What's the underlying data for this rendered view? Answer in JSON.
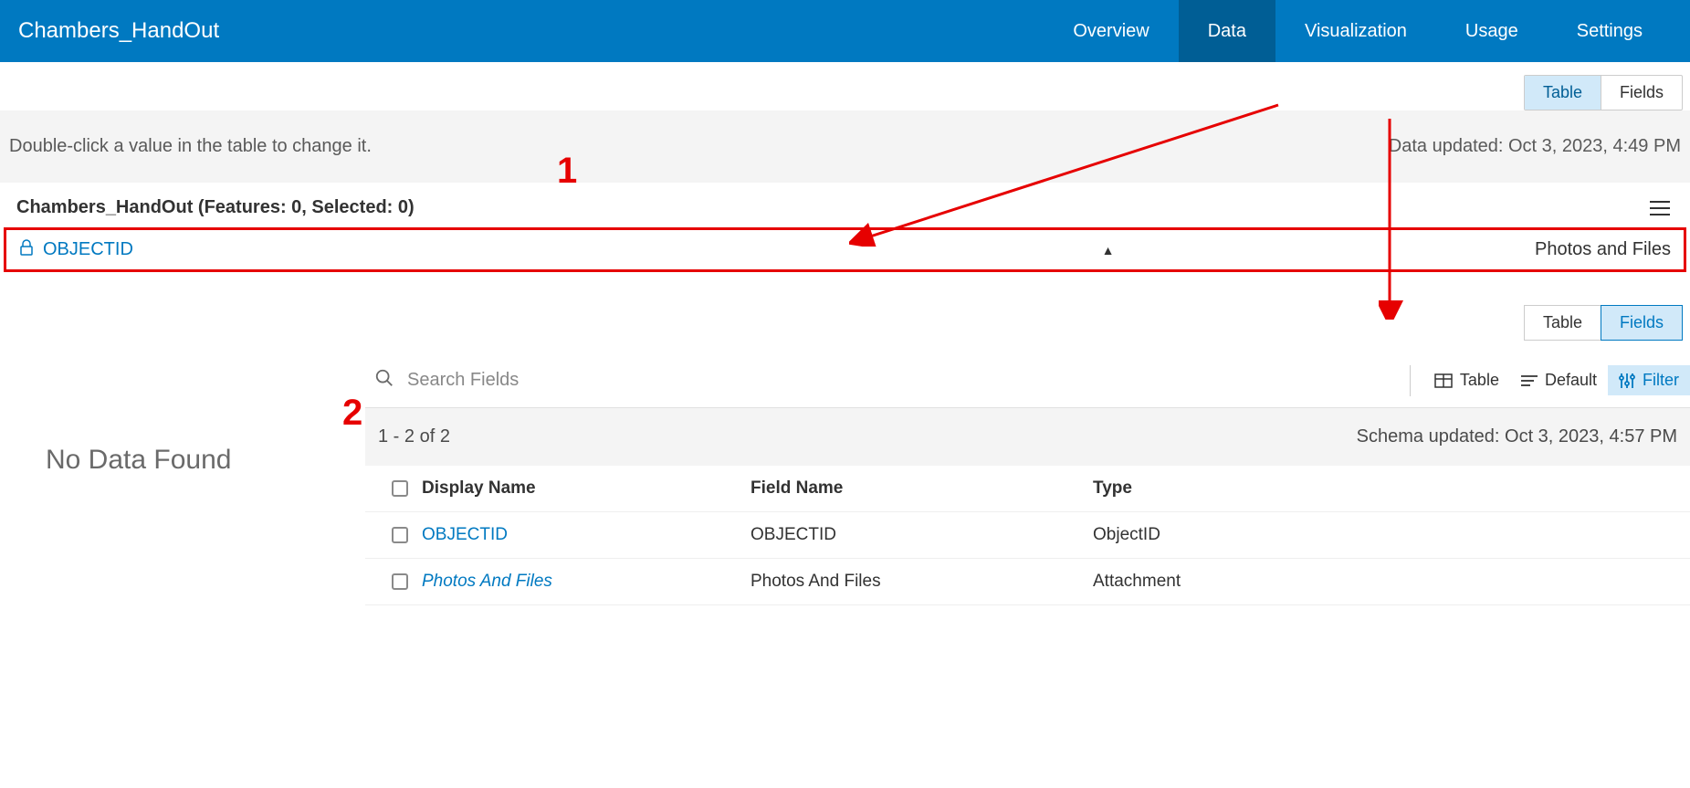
{
  "header": {
    "title": "Chambers_HandOut",
    "tabs": [
      "Overview",
      "Data",
      "Visualization",
      "Usage",
      "Settings"
    ],
    "active_tab": "Data"
  },
  "subtabs1": {
    "table": "Table",
    "fields": "Fields",
    "active": "Table"
  },
  "hint": "Double-click a value in the table to change it.",
  "data_updated": "Data updated: Oct 3, 2023, 4:49 PM",
  "layer": {
    "title": "Chambers_HandOut (Features: 0, Selected: 0)"
  },
  "table_columns": {
    "objectid": "OBJECTID",
    "photos": "Photos and Files"
  },
  "subtabs2": {
    "table": "Table",
    "fields": "Fields",
    "active": "Fields"
  },
  "no_data": "No Data Found",
  "search": {
    "placeholder": "Search Fields"
  },
  "toolbar": {
    "table": "Table",
    "default": "Default",
    "filter": "Filter"
  },
  "pagination": "1 - 2 of 2",
  "schema_updated": "Schema updated: Oct 3, 2023, 4:57 PM",
  "fields_table": {
    "headers": {
      "display": "Display Name",
      "field": "Field Name",
      "type": "Type"
    },
    "rows": [
      {
        "display": "OBJECTID",
        "field": "OBJECTID",
        "type": "ObjectID",
        "italic": false
      },
      {
        "display": "Photos And Files",
        "field": "Photos And Files",
        "type": "Attachment",
        "italic": true
      }
    ]
  },
  "annotations": {
    "one": "1",
    "two": "2"
  }
}
